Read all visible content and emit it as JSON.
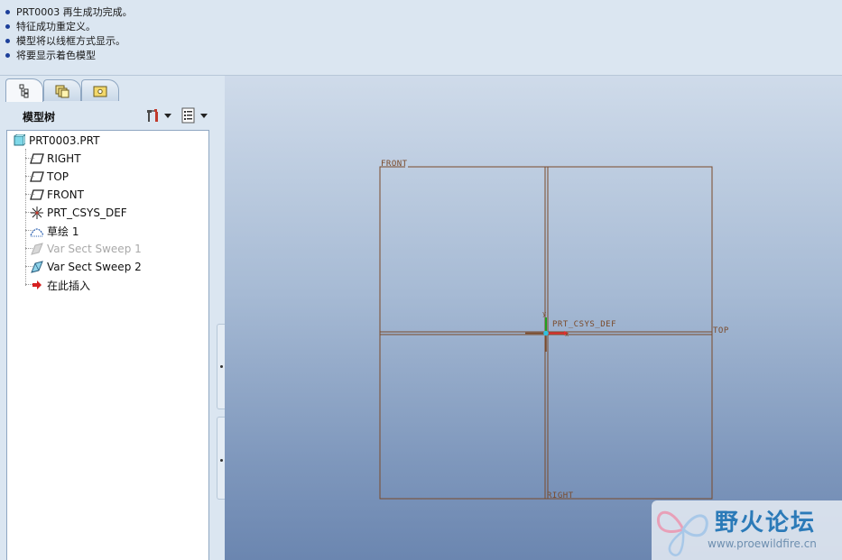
{
  "messages": [
    "PRT0003 再生成功完成。",
    "特征成功重定义。",
    "模型将以线框方式显示。",
    "将要显示着色模型"
  ],
  "tabs": [
    {
      "icon": "model-tree-tab-icon",
      "active": true
    },
    {
      "icon": "layers-tab-icon",
      "active": false
    },
    {
      "icon": "folder-browser-tab-icon",
      "active": false
    }
  ],
  "tree_header": {
    "title": "模型树",
    "settings_icon": "tools-icon",
    "show_icon": "list-settings-icon"
  },
  "tree": {
    "root": "PRT0003.PRT",
    "items": [
      {
        "label": "RIGHT",
        "icon": "datum-plane-icon",
        "disabled": false
      },
      {
        "label": "TOP",
        "icon": "datum-plane-icon",
        "disabled": false
      },
      {
        "label": "FRONT",
        "icon": "datum-plane-icon",
        "disabled": false
      },
      {
        "label": "PRT_CSYS_DEF",
        "icon": "coordinate-system-icon",
        "disabled": false
      },
      {
        "label": "草绘 1",
        "icon": "sketch-icon",
        "disabled": false
      },
      {
        "label": "Var Sect Sweep 1",
        "icon": "sweep-icon",
        "disabled": true
      },
      {
        "label": "Var Sect Sweep 2",
        "icon": "sweep-icon",
        "disabled": false
      },
      {
        "label": "在此插入",
        "icon": "insert-here-arrow-icon",
        "disabled": false
      }
    ]
  },
  "graphics": {
    "datum_labels": {
      "front": "FRONT",
      "top": "TOP",
      "right": "RIGHT",
      "csys": "PRT_CSYS_DEF",
      "axis_x": "x",
      "axis_y": "y"
    },
    "colors": {
      "datum": "#7a4a2a",
      "axis_x": "#e03030",
      "axis_y": "#20a020",
      "origin": "#30c0e0"
    }
  },
  "watermark": {
    "title": "野火论坛",
    "url": "www.proewildfire.cn"
  }
}
